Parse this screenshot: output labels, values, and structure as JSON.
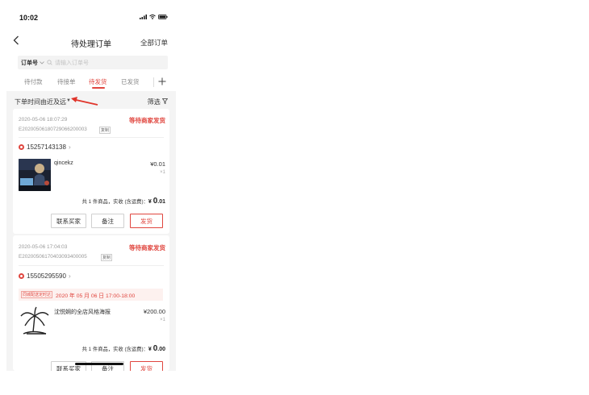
{
  "status_bar": {
    "time": "10:02"
  },
  "nav": {
    "back_icon": "chevron-left-icon",
    "title": "待处理订单",
    "right_link": "全部订单"
  },
  "search": {
    "field_label": "订单号",
    "placeholder": "请输入订单号"
  },
  "tabs": [
    {
      "label": "待付款",
      "active": false
    },
    {
      "label": "待接单",
      "active": false
    },
    {
      "label": "待发货",
      "active": true
    },
    {
      "label": "已发货",
      "active": false
    }
  ],
  "sort": {
    "label": "下单时间由近及远",
    "filter_label": "筛选"
  },
  "colors": {
    "accent": "#e0463f",
    "background": "#f4f4f4",
    "card": "#ffffff"
  },
  "orders": [
    {
      "datetime": "2020-05-06 18:07:29",
      "status": "等待商家发货",
      "order_no": "E20200506180729066200003",
      "copy_label": "复制",
      "buyer_phone": "15257143138",
      "product": {
        "name": "qincekz",
        "price": "¥0.01",
        "qty": "×1"
      },
      "summary_prefix": "共 1 件商品，实收 (含运费)：",
      "total_currency": "¥",
      "total_int": "0",
      "total_dec": ".01",
      "buttons": {
        "contact": "联系买家",
        "note": "备注",
        "ship": "发货"
      }
    },
    {
      "datetime": "2020-05-06 17:04:03",
      "status": "等待商家发货",
      "order_no": "E20200506170403093400005",
      "copy_label": "复制",
      "buyer_phone": "15505295590",
      "delivery_tag": "同城配送定时达",
      "delivery_time": "2020 年 05 月 06 日 17:00-18:00",
      "product": {
        "name": "沈悦娴的全店风格海报",
        "price": "¥200.00",
        "qty": "×1"
      },
      "summary_prefix": "共 1 件商品，实收 (含运费)：",
      "total_currency": "¥",
      "total_int": "0",
      "total_dec": ".00",
      "buttons": {
        "contact": "联系买家",
        "note": "备注",
        "ship": "发货"
      }
    }
  ]
}
